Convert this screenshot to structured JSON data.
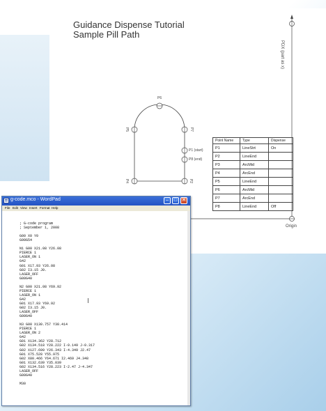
{
  "slide": {
    "title_line1": "Guidance Dispense Tutorial",
    "title_line2": "Sample Pill Path"
  },
  "diagram": {
    "points": {
      "p6": "P6",
      "p5": "P5",
      "p7": "P7",
      "p1": "P1 (start)",
      "p8": "P8 (end)",
      "p4": "P4",
      "p3": "P3",
      "p2": "P2"
    },
    "axis_label": "PDX (part as x)",
    "origin_label": "Origin",
    "table": {
      "headers": [
        "Point Name",
        "Type",
        "Dispense"
      ],
      "rows": [
        [
          "P1",
          "LineStrt",
          "On"
        ],
        [
          "P2",
          "LineEnd",
          ""
        ],
        [
          "P3",
          "ArcMid",
          ""
        ],
        [
          "P4",
          "ArcEnd",
          ""
        ],
        [
          "P5",
          "LineEnd",
          ""
        ],
        [
          "P6",
          "ArcMid",
          ""
        ],
        [
          "P7",
          "ArcEnd",
          ""
        ],
        [
          "P8",
          "LineEnd",
          "Off"
        ]
      ]
    }
  },
  "wordpad": {
    "title": "g-code.mco - WordPad",
    "menu": [
      "File",
      "Edit",
      "View",
      "Insert",
      "Format",
      "Help"
    ],
    "lines": [
      "; G-code program",
      "; September 1, 2008",
      "",
      "G00 X0 Y0",
      "G90G54",
      "",
      "N1 G00 X21.08 Y26.08",
      "PIERCE 1",
      "LASER_ON 1",
      "G42",
      "G01 X17.93 Y26.08",
      "G02 I3.15 J0.",
      "LASER_OFF",
      "G00G40",
      "",
      "N2 G00 X21.08 Y69.92",
      "PIERCE 1",
      "LASER_ON 1",
      "G42",
      "G01 X17.93 Y69.92",
      "G02 I3.15 J0.",
      "LASER_OFF",
      "G00G40",
      "",
      "N3 G00 X130.757 Y30.414",
      "PIERCE 1",
      "LASER_ON 2",
      "G42",
      "G01 X134.362 Y28.712",
      "G02 X134.518 Y28.222 I-0.149 J-0.317",
      "G02 X127.699 Y26.343 I-4.349 J2.47",
      "G01 X75.528 Y55.975",
      "G02 X80.466 Y64.671 I2.469 J4.348",
      "G01 X132.639 Y35.039",
      "G02 X134.516 Y28.223 I-2.47 J-4.347",
      "LASER_OFF",
      "G00G40",
      "",
      "M30"
    ]
  }
}
